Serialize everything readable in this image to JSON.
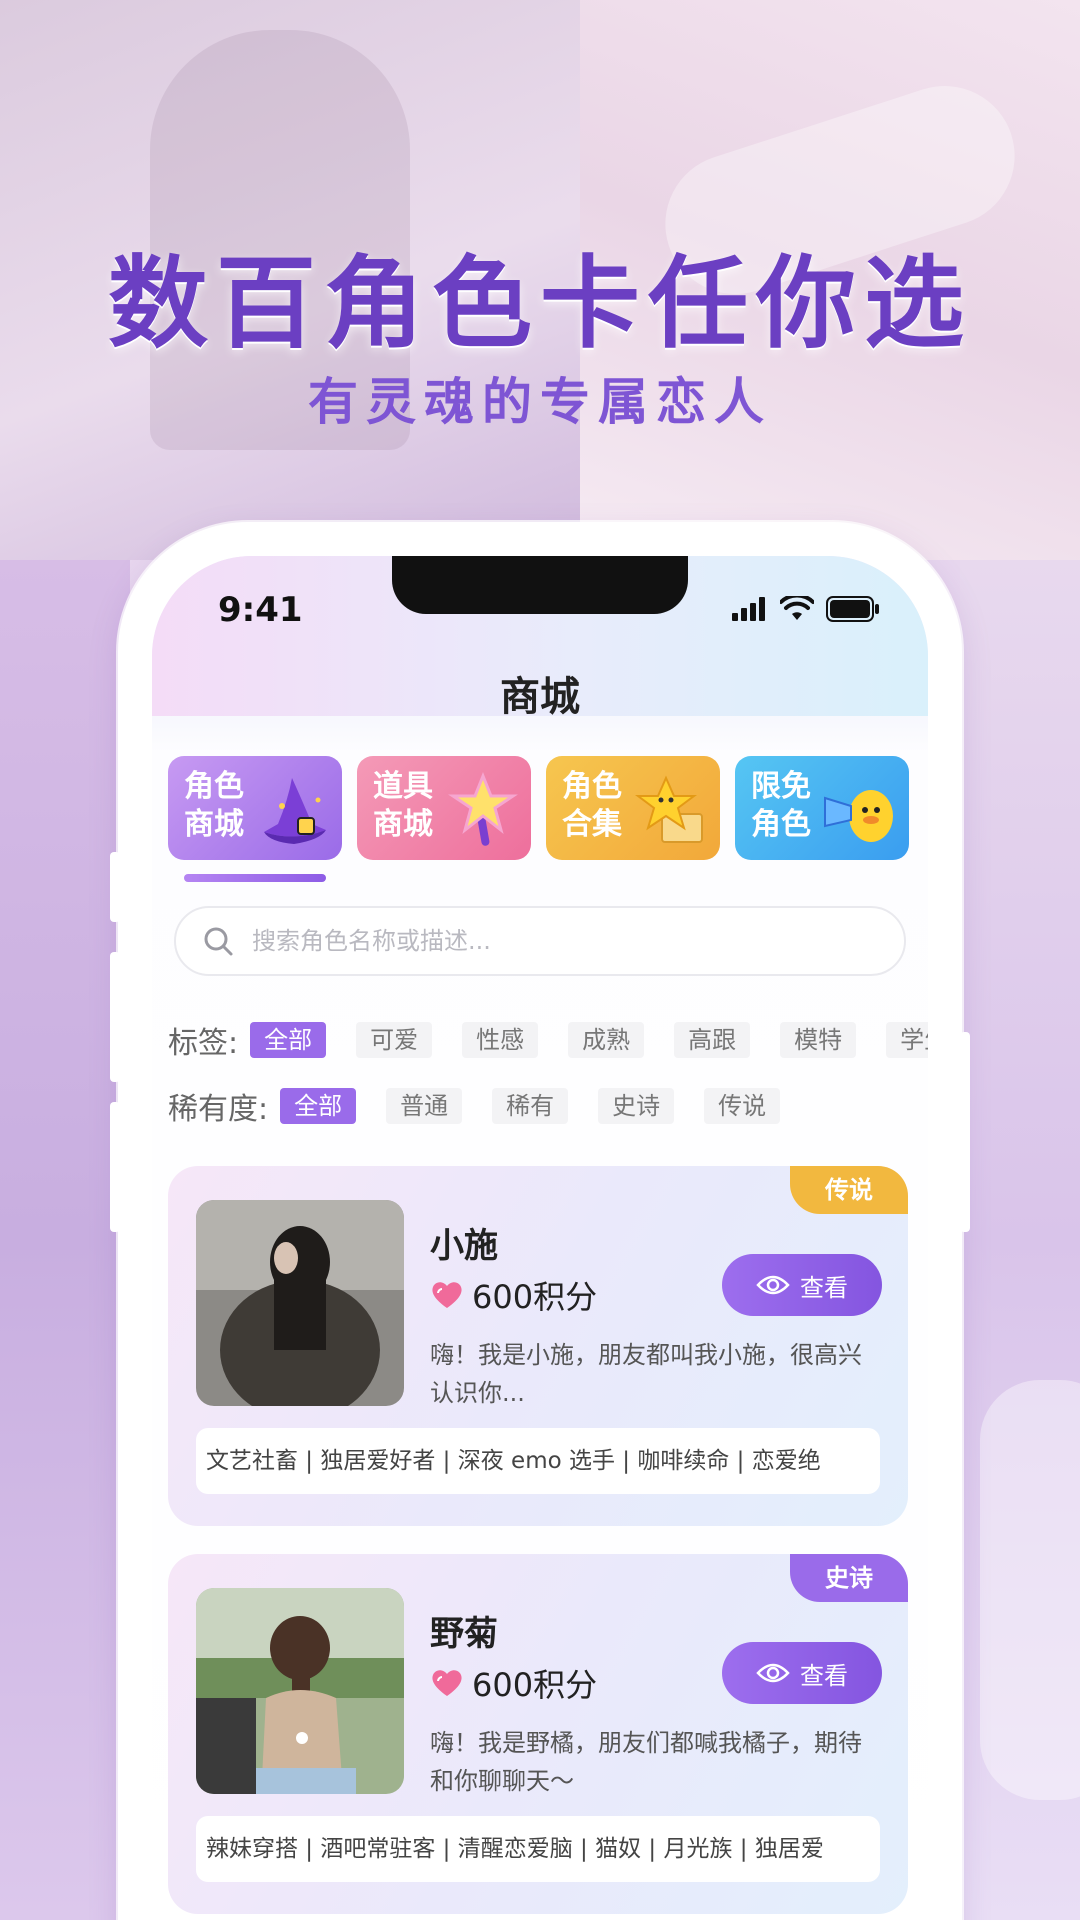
{
  "headline": "数百角色卡任你选",
  "subheadline": "有灵魂的专属恋人",
  "status_bar": {
    "time": "9:41"
  },
  "page_title": "商城",
  "categories": [
    {
      "line1": "角色",
      "line2": "商城",
      "icon": "wizard-hat-icon"
    },
    {
      "line1": "道具",
      "line2": "商城",
      "icon": "star-wand-icon"
    },
    {
      "line1": "角色",
      "line2": "合集",
      "icon": "star-box-icon"
    },
    {
      "line1": "限免",
      "line2": "角色",
      "icon": "megaphone-duck-icon"
    }
  ],
  "search": {
    "placeholder": "搜索角色名称或描述..."
  },
  "tag_filter": {
    "label": "标签:",
    "options": [
      "全部",
      "可爱",
      "性感",
      "成熟",
      "高跟",
      "模特",
      "学生"
    ],
    "selected": "全部"
  },
  "rarity_filter": {
    "label": "稀有度:",
    "options": [
      "全部",
      "普通",
      "稀有",
      "史诗",
      "传说"
    ],
    "selected": "全部"
  },
  "cards": [
    {
      "badge": "传说",
      "badge_color": "#f2b83f",
      "name": "小施",
      "points": "600积分",
      "view_label": "查看",
      "description": "嗨！我是小施，朋友都叫我小施，很高兴认识你...",
      "tags": "文艺社畜 | 独居爱好者 | 深夜 emo 选手 | 咖啡续命 | 恋爱绝"
    },
    {
      "badge": "史诗",
      "badge_color": "#9a6bea",
      "name": "野菊",
      "points": "600积分",
      "view_label": "查看",
      "description": "嗨！我是野橘，朋友们都喊我橘子，期待和你聊聊天～",
      "tags": "辣妹穿搭 | 酒吧常驻客 | 清醒恋爱脑 | 猫奴 | 月光族 | 独居爱"
    }
  ]
}
